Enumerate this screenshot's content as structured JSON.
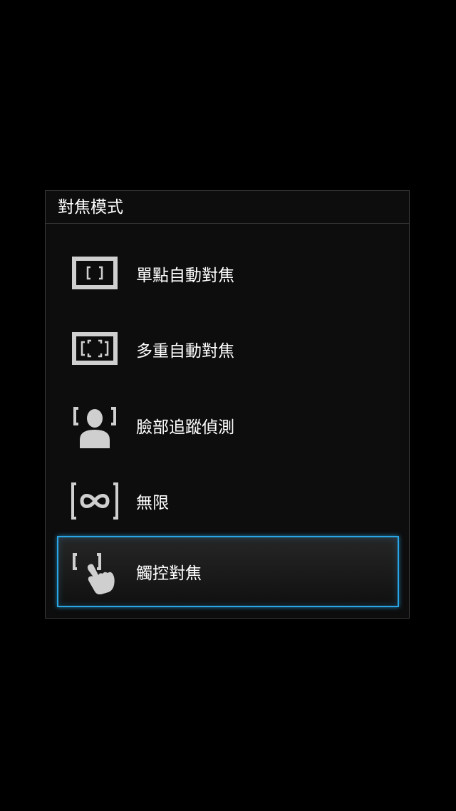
{
  "dialog": {
    "title": "對焦模式",
    "options": [
      {
        "label": "單點自動對焦",
        "icon": "single-focus-icon",
        "selected": false
      },
      {
        "label": "多重自動對焦",
        "icon": "multi-focus-icon",
        "selected": false
      },
      {
        "label": "臉部追蹤偵測",
        "icon": "face-detection-icon",
        "selected": false
      },
      {
        "label": "無限",
        "icon": "infinity-icon",
        "selected": false
      },
      {
        "label": "觸控對焦",
        "icon": "touch-focus-icon",
        "selected": true
      }
    ]
  },
  "colors": {
    "background": "#000000",
    "dialog_bg": "#0d0d0d",
    "accent": "#2aa6e6",
    "icon": "#cfcfcf",
    "text": "#ffffff"
  }
}
